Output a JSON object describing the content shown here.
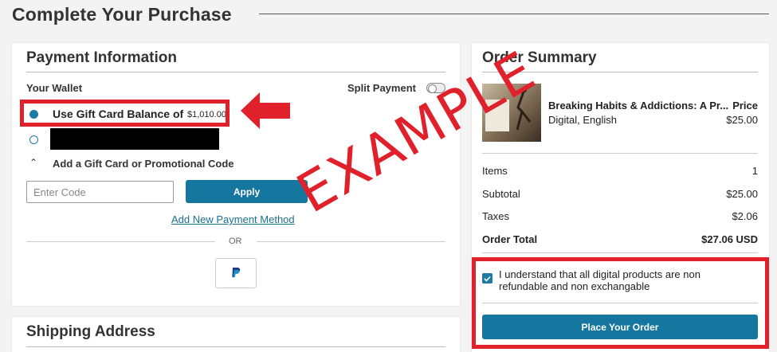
{
  "page": {
    "title": "Complete Your Purchase"
  },
  "payment": {
    "title": "Payment Information",
    "wallet_label": "Your Wallet",
    "split_payment_label": "Split Payment",
    "gift_card_label": "Use Gift Card Balance of",
    "gift_card_amount": "$1,010.00",
    "add_code_label": "Add a Gift Card or Promotional Code",
    "code_placeholder": "Enter Code",
    "apply_label": "Apply",
    "add_method_label": "Add New Payment Method",
    "or_label": "OR",
    "paypal_icon": "paypal-icon"
  },
  "shipping": {
    "title": "Shipping Address"
  },
  "summary": {
    "title": "Order Summary",
    "product_title": "Breaking Habits & Addictions: A Pr...",
    "product_format": "Digital, English",
    "price_label": "Price",
    "price_value": "$25.00",
    "items_label": "Items",
    "items_value": "1",
    "subtotal_label": "Subtotal",
    "subtotal_value": "$25.00",
    "taxes_label": "Taxes",
    "taxes_value": "$2.06",
    "total_label": "Order Total",
    "total_value": "$27.06 USD",
    "ack_text": "I understand that all digital products are non refundable and non exchangable",
    "place_order_label": "Place Your Order"
  },
  "watermark": "EXAMPLE",
  "colors": {
    "accent": "#15779f",
    "highlight": "#e0202a"
  }
}
